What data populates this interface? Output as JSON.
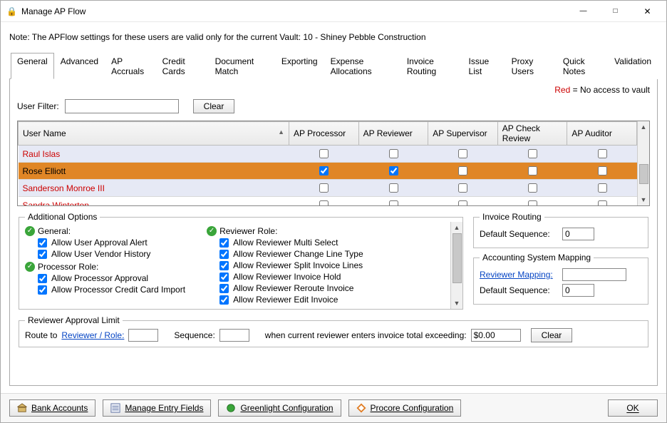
{
  "window": {
    "title": "Manage AP Flow"
  },
  "note": "Note:  The APFlow settings for these users are valid only for the current Vault: 10 - Shiney Pebble Construction",
  "tabs": [
    "General",
    "Advanced",
    "AP Accruals",
    "Credit Cards",
    "Document Match",
    "Exporting",
    "Expense Allocations",
    "Invoice Routing",
    "Issue List",
    "Proxy Users",
    "Quick Notes",
    "Validation"
  ],
  "active_tab": "General",
  "legend": {
    "red_label": "Red",
    "red_desc": " = No access to vault"
  },
  "filter": {
    "label": "User Filter:",
    "value": "",
    "clear": "Clear"
  },
  "table": {
    "columns": [
      "User Name",
      "AP Processor",
      "AP Reviewer",
      "AP Supervisor",
      "AP Check Review",
      "AP Auditor"
    ],
    "rows": [
      {
        "name": "Raul Islas",
        "no_access": true,
        "selected": false,
        "flags": [
          false,
          false,
          false,
          false,
          false
        ]
      },
      {
        "name": "Rose Elliott",
        "no_access": false,
        "selected": true,
        "flags": [
          true,
          true,
          false,
          false,
          false
        ]
      },
      {
        "name": "Sanderson Monroe III",
        "no_access": true,
        "selected": false,
        "flags": [
          false,
          false,
          false,
          false,
          false
        ]
      },
      {
        "name": "Sandra Winterton",
        "no_access": true,
        "selected": false,
        "flags": [
          false,
          false,
          false,
          false,
          false
        ]
      }
    ]
  },
  "additional": {
    "legend": "Additional Options",
    "general": {
      "title": "General:",
      "items": [
        {
          "label": "Allow User Approval Alert",
          "checked": true
        },
        {
          "label": "Allow User Vendor History",
          "checked": true
        }
      ]
    },
    "processor": {
      "title": "Processor Role:",
      "items": [
        {
          "label": "Allow Processor Approval",
          "checked": true
        },
        {
          "label": "Allow Processor Credit Card Import",
          "checked": true
        }
      ]
    },
    "reviewer": {
      "title": "Reviewer Role:",
      "items": [
        {
          "label": "Allow Reviewer Multi Select",
          "checked": true
        },
        {
          "label": "Allow Reviewer Change Line Type",
          "checked": true
        },
        {
          "label": "Allow Reviewer Split Invoice Lines",
          "checked": true
        },
        {
          "label": "Allow Reviewer Invoice Hold",
          "checked": true
        },
        {
          "label": "Allow Reviewer Reroute Invoice",
          "checked": true
        },
        {
          "label": "Allow Reviewer Edit Invoice",
          "checked": true
        }
      ]
    }
  },
  "invoice_routing": {
    "legend": "Invoice Routing",
    "default_sequence_label": "Default Sequence:",
    "default_sequence_value": "0"
  },
  "accounting_mapping": {
    "legend": "Accounting System Mapping",
    "reviewer_mapping_label": "Reviewer Mapping:",
    "reviewer_mapping_value": "",
    "default_sequence_label": "Default Sequence:",
    "default_sequence_value": "0"
  },
  "ral": {
    "legend": "Reviewer Approval Limit",
    "route_to": "Route to",
    "reviewer_role_link": "Reviewer / Role:",
    "reviewer_role_value": "",
    "sequence_label": "Sequence:",
    "sequence_value": "",
    "when_text": "when current reviewer enters invoice total exceeding:",
    "amount": "$0.00",
    "clear": "Clear"
  },
  "footer": {
    "bank": "Bank Accounts",
    "entry": "Manage Entry Fields",
    "greenlight": "Greenlight Configuration",
    "procore": "Procore Configuration",
    "ok": "OK"
  }
}
